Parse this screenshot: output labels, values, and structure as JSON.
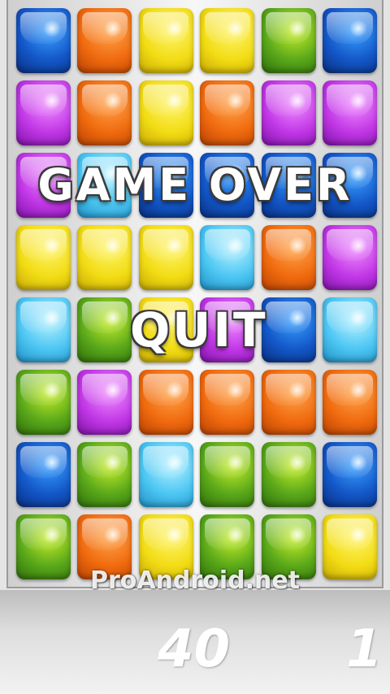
{
  "board": {
    "rows": [
      [
        "blue",
        "orange",
        "yellow",
        "yellow",
        "green",
        "blue"
      ],
      [
        "purple",
        "orange",
        "yellow",
        "orange",
        "purple",
        "purple"
      ],
      [
        "purple",
        "cyan",
        "blue",
        "blue",
        "blue",
        "blue"
      ],
      [
        "yellow",
        "yellow",
        "yellow",
        "cyan",
        "orange",
        "purple"
      ],
      [
        "cyan",
        "green",
        "yellow",
        "purple",
        "blue",
        "cyan"
      ],
      [
        "green",
        "purple",
        "orange",
        "orange",
        "orange",
        "orange"
      ],
      [
        "blue",
        "green",
        "cyan",
        "green",
        "green",
        "blue"
      ],
      [
        "green",
        "orange",
        "yellow",
        "green",
        "green",
        "yellow"
      ]
    ]
  },
  "overlay": {
    "title": "GAME OVER",
    "quit_label": "QUIT"
  },
  "watermark": "ProAndroid.net",
  "status": {
    "score": "40",
    "level": "1"
  },
  "colors": {
    "blue": "#1357c8",
    "orange": "#f06a0e",
    "yellow": "#f2dc14",
    "green": "#5aa81a",
    "purple": "#c137e6",
    "cyan": "#4cc6f3"
  }
}
